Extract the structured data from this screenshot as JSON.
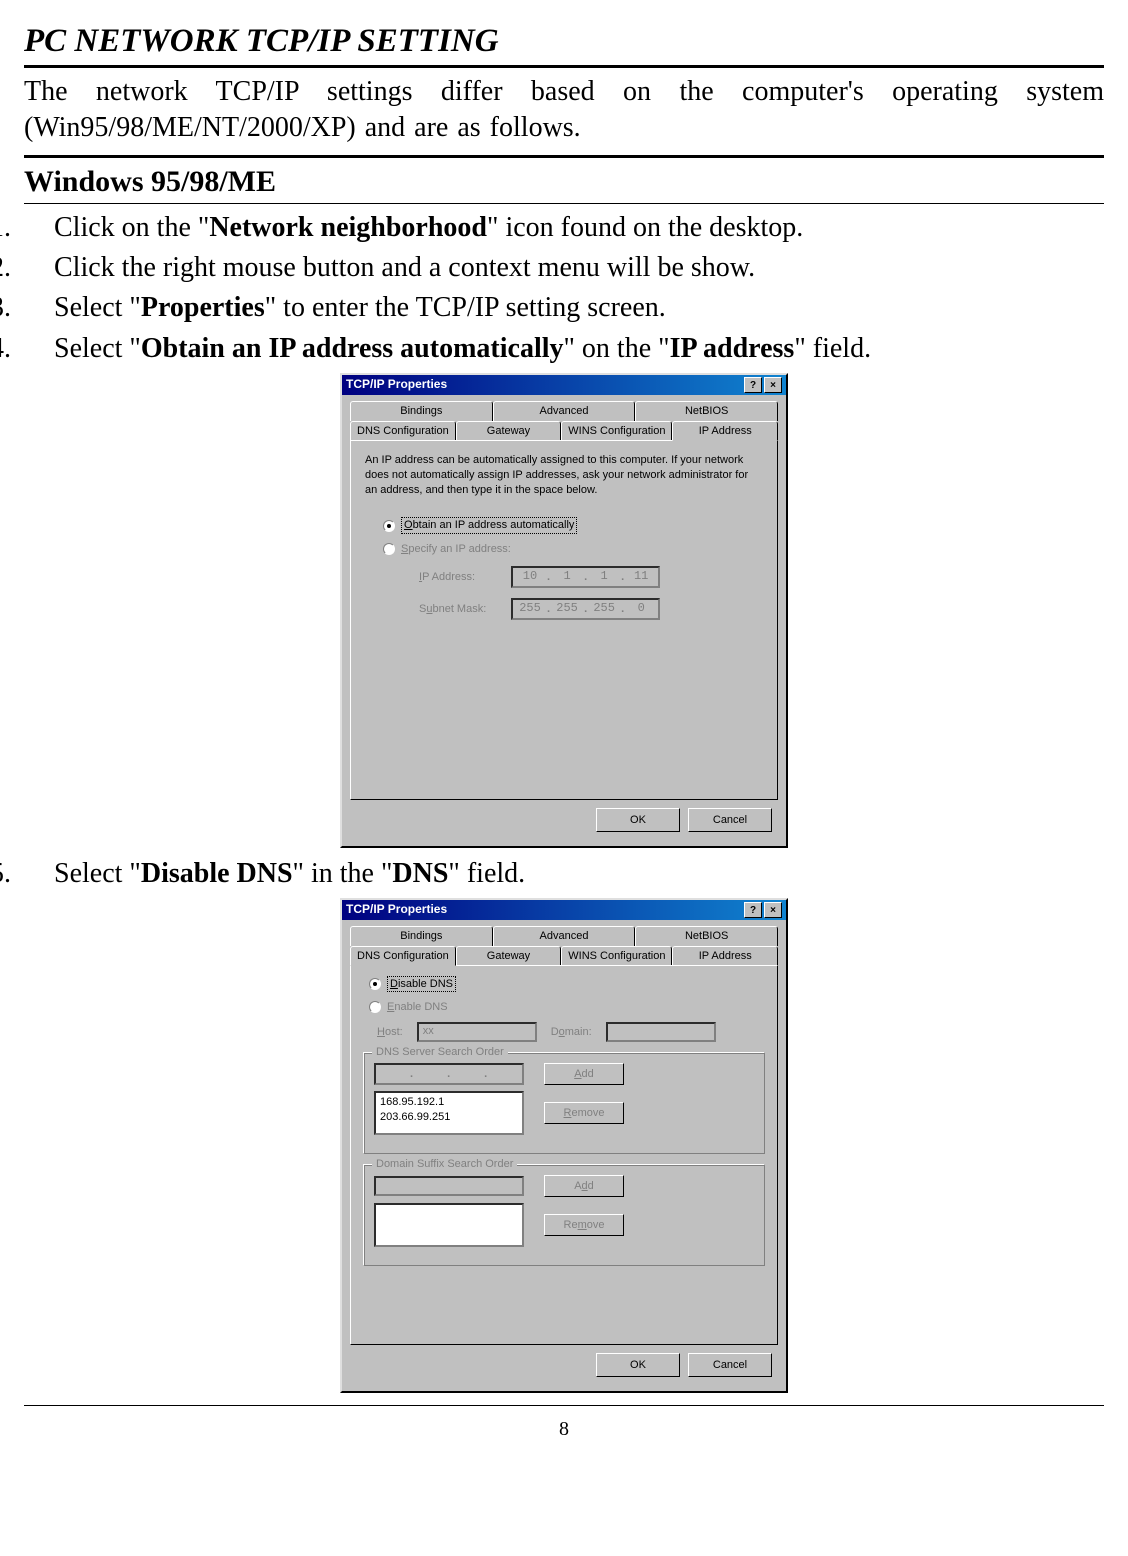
{
  "page": {
    "title": "PC NETWORK TCP/IP SETTING",
    "intro": "The network TCP/IP settings differ based on the computer's operating system (Win95/98/ME/NT/2000/XP) and are as follows.",
    "section_title": "Windows 95/98/ME",
    "page_number": "8"
  },
  "steps": {
    "s1_pre": "Click on the \"",
    "s1_bold": "Network neighborhood",
    "s1_post": "\" icon found on the desktop.",
    "s2": "Click the right mouse button and a context menu will be show.",
    "s3_pre": "Select \"",
    "s3_bold": "Properties",
    "s3_post": "\" to enter the TCP/IP setting screen.",
    "s4_pre": "Select \"",
    "s4_bold": "Obtain an IP address automatically",
    "s4_mid": "\" on the \"",
    "s4_bold2": "IP address",
    "s4_post": "\" field.",
    "s5_pre": "Select \"",
    "s5_bold": "Disable DNS",
    "s5_mid": "\" in the \"",
    "s5_bold2": "DNS",
    "s5_post": "\" field."
  },
  "dialog1": {
    "title": "TCP/IP Properties",
    "help_btn": "?",
    "close_btn": "×",
    "tabs_back": [
      "Bindings",
      "Advanced",
      "NetBIOS"
    ],
    "tabs_front": [
      "DNS Configuration",
      "Gateway",
      "WINS Configuration",
      "IP Address"
    ],
    "active_tab": "IP Address",
    "description": "An IP address can be automatically assigned to this computer. If your network does not automatically assign IP addresses, ask your network administrator for an address, and then type it in the space below.",
    "radio_obtain": "Obtain an IP address automatically",
    "radio_specify": "Specify an IP address:",
    "ip_label": "IP Address:",
    "ip_value": [
      "10",
      "1",
      "1",
      "11"
    ],
    "subnet_label": "Subnet Mask:",
    "subnet_value": [
      "255",
      "255",
      "255",
      "0"
    ],
    "ok": "OK",
    "cancel": "Cancel"
  },
  "dialog2": {
    "title": "TCP/IP Properties",
    "help_btn": "?",
    "close_btn": "×",
    "tabs_back": [
      "Bindings",
      "Advanced",
      "NetBIOS"
    ],
    "tabs_front": [
      "DNS Configuration",
      "Gateway",
      "WINS Configuration",
      "IP Address"
    ],
    "active_tab": "DNS Configuration",
    "radio_disable": "Disable DNS",
    "radio_enable": "Enable DNS",
    "host_label": "Host:",
    "host_value": "xx",
    "domain_label": "Domain:",
    "dns_order_legend": "DNS Server Search Order",
    "add_btn": "Add",
    "remove_btn": "Remove",
    "dns_list": [
      "168.95.192.1",
      "203.66.99.251"
    ],
    "suffix_legend": "Domain Suffix Search Order",
    "ok": "OK",
    "cancel": "Cancel"
  }
}
